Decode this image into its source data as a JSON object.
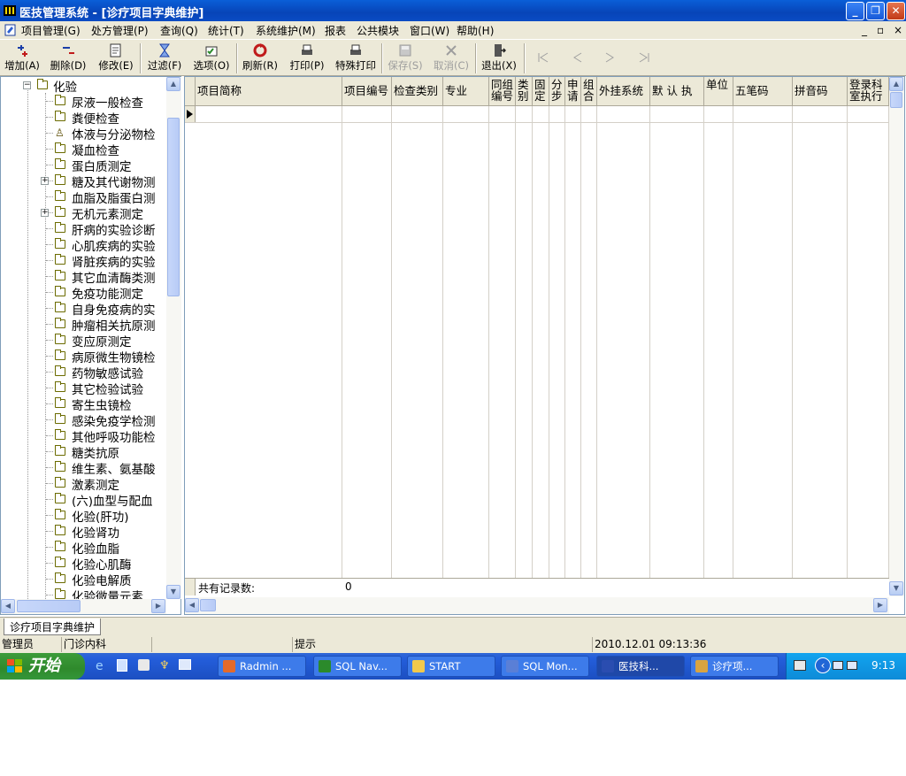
{
  "window": {
    "title": "医技管理系统 - [诊疗项目字典维护]"
  },
  "menu": {
    "items": [
      "项目管理(G)",
      "处方管理(P)",
      "查询(Q)",
      "统计(T)",
      "系统维护(M)",
      "报表",
      "公共模块",
      "窗口(W)",
      "帮助(H)"
    ],
    "mdi_controls": [
      "_",
      "▫",
      "×"
    ]
  },
  "toolbar": {
    "buttons": [
      {
        "label": "增加(A)",
        "icon": "add-icon",
        "enabled": true
      },
      {
        "label": "删除(D)",
        "icon": "delete-icon",
        "enabled": true
      },
      {
        "label": "修改(E)",
        "icon": "edit-icon",
        "enabled": true
      },
      {
        "label": "过滤(F)",
        "icon": "hourglass-filter-icon",
        "enabled": true
      },
      {
        "label": "选项(O)",
        "icon": "options-icon",
        "enabled": true
      },
      {
        "label": "刷新(R)",
        "icon": "refresh-icon",
        "enabled": true
      },
      {
        "label": "打印(P)",
        "icon": "print-icon",
        "enabled": true
      },
      {
        "label": "特殊打印",
        "icon": "special-print-icon",
        "enabled": true
      },
      {
        "label": "保存(S)",
        "icon": "save-icon",
        "enabled": false
      },
      {
        "label": "取消(C)",
        "icon": "cancel-icon",
        "enabled": false
      },
      {
        "label": "退出(X)",
        "icon": "exit-icon",
        "enabled": true
      }
    ],
    "nav_icons": [
      "first-record-icon",
      "previous-record-icon",
      "next-record-icon",
      "last-record-icon"
    ]
  },
  "tree": {
    "root": "化验",
    "items": [
      {
        "label": "尿液一般检查",
        "expandable": false
      },
      {
        "label": "粪便检查",
        "expandable": false
      },
      {
        "label": "体液与分泌物检",
        "expandable": false,
        "selected_icon": true
      },
      {
        "label": "凝血检查",
        "expandable": false
      },
      {
        "label": "蛋白质测定",
        "expandable": false
      },
      {
        "label": "糖及其代谢物测",
        "expandable": true
      },
      {
        "label": "血脂及脂蛋白测",
        "expandable": false
      },
      {
        "label": "无机元素测定",
        "expandable": true
      },
      {
        "label": "肝病的实验诊断",
        "expandable": false
      },
      {
        "label": "心肌疾病的实验",
        "expandable": false
      },
      {
        "label": "肾脏疾病的实验",
        "expandable": false
      },
      {
        "label": "其它血清酶类测",
        "expandable": false
      },
      {
        "label": "免疫功能测定",
        "expandable": false
      },
      {
        "label": "自身免疫病的实",
        "expandable": false
      },
      {
        "label": "肿瘤相关抗原测",
        "expandable": false
      },
      {
        "label": "变应原测定",
        "expandable": false
      },
      {
        "label": "病原微生物镜检",
        "expandable": false
      },
      {
        "label": "药物敏感试验",
        "expandable": false
      },
      {
        "label": "其它检验试验",
        "expandable": false
      },
      {
        "label": "寄生虫镜检",
        "expandable": false
      },
      {
        "label": "感染免疫学检测",
        "expandable": false
      },
      {
        "label": "其他呼吸功能检",
        "expandable": false
      },
      {
        "label": "糖类抗原",
        "expandable": false
      },
      {
        "label": "维生素、氨基酸",
        "expandable": false
      },
      {
        "label": "激素测定",
        "expandable": false
      },
      {
        "label": "(六)血型与配血",
        "expandable": false
      },
      {
        "label": "化验(肝功)",
        "expandable": false
      },
      {
        "label": "化验肾功",
        "expandable": false
      },
      {
        "label": "化验血脂",
        "expandable": false
      },
      {
        "label": "化验心肌酶",
        "expandable": false
      },
      {
        "label": "化验电解质",
        "expandable": false
      },
      {
        "label": "化验微量元素",
        "expandable": false
      }
    ]
  },
  "grid": {
    "columns": [
      "项目简称",
      "项目编号",
      "检查类别",
      "专业",
      "同组编号",
      "类别",
      "固定",
      "分步",
      "申请",
      "组合",
      "外挂系统接口编码",
      "默 认 执行 科 室",
      "单位",
      "五笔码",
      "拼音码",
      "登录科室执行"
    ],
    "footer_label": "共有记录数:",
    "record_count": "0"
  },
  "tabs": [
    "诊疗项目字典维护"
  ],
  "status": {
    "user": "管理员",
    "dept": "门诊内科",
    "empty": "",
    "hint": "提示",
    "datetime": "2010.12.01  09:13:36"
  },
  "taskbar": {
    "start": "开始",
    "tasks": [
      {
        "label": "Radmin ...",
        "active": false
      },
      {
        "label": "SQL Nav...",
        "active": false
      },
      {
        "label": "START",
        "active": false
      },
      {
        "label": "SQL Mon...",
        "active": false
      },
      {
        "label": "医技科...",
        "active": true
      },
      {
        "label": "诊疗项...",
        "active": false
      }
    ],
    "clock": "9:13"
  },
  "colors": {
    "title_bar": "#0a53d2",
    "chrome": "#ece9d8",
    "taskbar": "#245edb",
    "start_button": "#3c9c3a",
    "tray": "#0f97e3"
  }
}
